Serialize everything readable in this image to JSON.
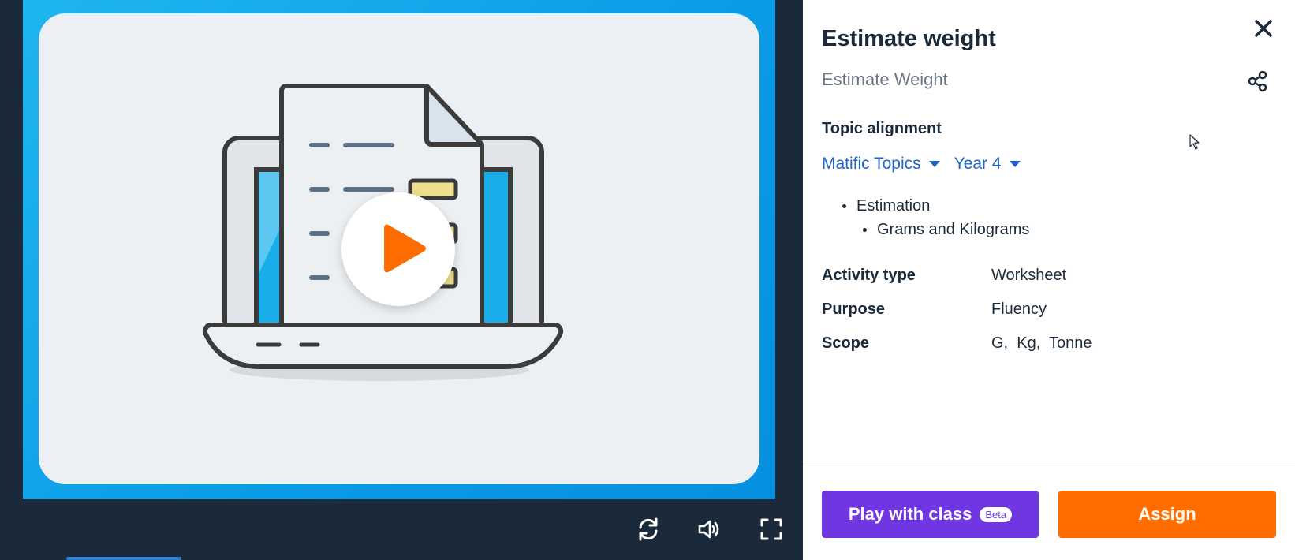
{
  "activity": {
    "title": "Estimate weight",
    "subtitle": "Estimate Weight"
  },
  "topic_alignment": {
    "heading": "Topic alignment",
    "curriculum_select": "Matific Topics",
    "year_select": "Year 4",
    "topics": [
      "Estimation"
    ],
    "subtopics": [
      "Grams and Kilograms"
    ]
  },
  "details": [
    {
      "key": "Activity type",
      "value": "Worksheet"
    },
    {
      "key": "Purpose",
      "value": "Fluency"
    },
    {
      "key": "Scope",
      "value": "G,  Kg,  Tonne"
    }
  ],
  "actions": {
    "play_label": "Play with class",
    "beta_label": "Beta",
    "assign_label": "Assign"
  },
  "player": {
    "controls": [
      "restart-icon",
      "volume-icon",
      "fullscreen-icon"
    ]
  },
  "colors": {
    "brand_purple": "#6f36e2",
    "brand_orange": "#ff6c00",
    "link_blue": "#1f63c7",
    "dark_navy": "#1b2a3a",
    "video_blue": "#0a9be6"
  }
}
